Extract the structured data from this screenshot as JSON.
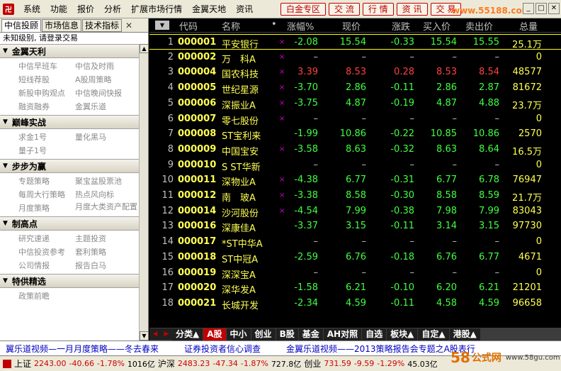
{
  "menu": [
    "系统",
    "功能",
    "报价",
    "分析",
    "扩展市场行情",
    "金翼天地",
    "资讯"
  ],
  "quick_buttons": [
    "白金专区",
    "交 流",
    "行 情",
    "资 讯",
    "交 易"
  ],
  "watermark_top": "www.55188.com",
  "window_controls": [
    "_",
    "□",
    "✕"
  ],
  "left_panel": {
    "tabs": [
      "中信投顾",
      "市场信息",
      "技术指标"
    ],
    "close": "✕",
    "login_msg": "未知级别, 请登录交易",
    "sections": [
      {
        "title": "金翼天利",
        "items": [
          "中信早班车",
          "中信及时雨",
          "短线荐股",
          "A股周策略",
          "新股申购观点",
          "中信晚间快报",
          "融资融券",
          "金翼乐道"
        ]
      },
      {
        "title": "巅峰实战",
        "items": [
          "求金1号",
          "量化黑马",
          "量子1号"
        ]
      },
      {
        "title": "步步为赢",
        "items": [
          "专题策略",
          "聚宝盆股票池",
          "每周大行策略",
          "热点风向标",
          "月度策略",
          "月度大类资产配置"
        ]
      },
      {
        "title": "制高点",
        "items": [
          "研究速递",
          "主题投资",
          "中信投资参考",
          "套利策略",
          "公司情报",
          "报告白马"
        ]
      },
      {
        "title": "特供精选",
        "items": [
          "政策前瞻"
        ]
      }
    ]
  },
  "table": {
    "headers": {
      "code": "代码",
      "name": "名称",
      "dot": "•",
      "pct": "涨幅%",
      "price": "现价",
      "chg": "涨跌",
      "buy": "买入价",
      "sell": "卖出价",
      "vol": "总量"
    },
    "rows": [
      {
        "idx": "1",
        "code": "000001",
        "name": "平安银行",
        "mark": "×",
        "pct": "-2.08",
        "price": "15.54",
        "chg": "-0.33",
        "buy": "15.54",
        "sell": "15.55",
        "vol": "25.1万",
        "dir": "down"
      },
      {
        "idx": "2",
        "code": "000002",
        "name": "万　科A",
        "mark": "×",
        "pct": "–",
        "price": "–",
        "chg": "–",
        "buy": "–",
        "sell": "–",
        "vol": "0",
        "dir": "flat"
      },
      {
        "idx": "3",
        "code": "000004",
        "name": "国农科技",
        "mark": "×",
        "pct": "3.39",
        "price": "8.53",
        "chg": "0.28",
        "buy": "8.53",
        "sell": "8.54",
        "vol": "48577",
        "dir": "up"
      },
      {
        "idx": "4",
        "code": "000005",
        "name": "世纪星源",
        "mark": "×",
        "pct": "-3.70",
        "price": "2.86",
        "chg": "-0.11",
        "buy": "2.86",
        "sell": "2.87",
        "vol": "81672",
        "dir": "down"
      },
      {
        "idx": "5",
        "code": "000006",
        "name": "深振业A",
        "mark": "×",
        "pct": "-3.75",
        "price": "4.87",
        "chg": "-0.19",
        "buy": "4.87",
        "sell": "4.88",
        "vol": "23.7万",
        "dir": "down"
      },
      {
        "idx": "6",
        "code": "000007",
        "name": "零七股份",
        "mark": "×",
        "pct": "–",
        "price": "–",
        "chg": "–",
        "buy": "–",
        "sell": "–",
        "vol": "0",
        "dir": "flat"
      },
      {
        "idx": "7",
        "code": "000008",
        "name": "ST宝利来",
        "mark": "",
        "pct": "-1.99",
        "price": "10.86",
        "chg": "-0.22",
        "buy": "10.85",
        "sell": "10.86",
        "vol": "2570",
        "dir": "down"
      },
      {
        "idx": "8",
        "code": "000009",
        "name": "中国宝安",
        "mark": "×",
        "pct": "-3.58",
        "price": "8.63",
        "chg": "-0.32",
        "buy": "8.63",
        "sell": "8.64",
        "vol": "16.5万",
        "dir": "down"
      },
      {
        "idx": "9",
        "code": "000010",
        "name": "S ST华新",
        "mark": "",
        "pct": "–",
        "price": "–",
        "chg": "–",
        "buy": "–",
        "sell": "–",
        "vol": "0",
        "dir": "flat"
      },
      {
        "idx": "10",
        "code": "000011",
        "name": "深物业A",
        "mark": "×",
        "pct": "-4.38",
        "price": "6.77",
        "chg": "-0.31",
        "buy": "6.77",
        "sell": "6.78",
        "vol": "76947",
        "dir": "down"
      },
      {
        "idx": "11",
        "code": "000012",
        "name": "南　玻A",
        "mark": "×",
        "pct": "-3.38",
        "price": "8.58",
        "chg": "-0.30",
        "buy": "8.58",
        "sell": "8.59",
        "vol": "21.7万",
        "dir": "down"
      },
      {
        "idx": "12",
        "code": "000014",
        "name": "沙河股份",
        "mark": "×",
        "pct": "-4.54",
        "price": "7.99",
        "chg": "-0.38",
        "buy": "7.98",
        "sell": "7.99",
        "vol": "83043",
        "dir": "down"
      },
      {
        "idx": "13",
        "code": "000016",
        "name": "深康佳A",
        "mark": "",
        "pct": "-3.37",
        "price": "3.15",
        "chg": "-0.11",
        "buy": "3.14",
        "sell": "3.15",
        "vol": "97730",
        "dir": "down"
      },
      {
        "idx": "14",
        "code": "000017",
        "name": "*ST中华A",
        "mark": "",
        "pct": "–",
        "price": "–",
        "chg": "–",
        "buy": "–",
        "sell": "–",
        "vol": "0",
        "dir": "flat"
      },
      {
        "idx": "15",
        "code": "000018",
        "name": "ST中冠A",
        "mark": "",
        "pct": "-2.59",
        "price": "6.76",
        "chg": "-0.18",
        "buy": "6.76",
        "sell": "6.77",
        "vol": "4671",
        "dir": "down"
      },
      {
        "idx": "16",
        "code": "000019",
        "name": "深深宝A",
        "mark": "",
        "pct": "–",
        "price": "–",
        "chg": "–",
        "buy": "–",
        "sell": "–",
        "vol": "0",
        "dir": "flat"
      },
      {
        "idx": "17",
        "code": "000020",
        "name": "深华发A",
        "mark": "",
        "pct": "-1.58",
        "price": "6.21",
        "chg": "-0.10",
        "buy": "6.20",
        "sell": "6.21",
        "vol": "21201",
        "dir": "down"
      },
      {
        "idx": "18",
        "code": "000021",
        "name": "长城开发",
        "mark": "",
        "pct": "-2.34",
        "price": "4.59",
        "chg": "-0.11",
        "buy": "4.58",
        "sell": "4.59",
        "vol": "96658",
        "dir": "down"
      }
    ]
  },
  "bottom_tabs": [
    "分类▲",
    "A股",
    "中小",
    "创业",
    "B股",
    "基金",
    "AH对照",
    "自选",
    "板块▲",
    "自定▲",
    "港股▲"
  ],
  "bottom_active": "A股",
  "ticker": [
    "翼乐道视频—一月月度策略——冬去春来",
    "证券投资者信心调查",
    "金翼乐道视频——2013策略报告会专题之A股表行"
  ],
  "status": {
    "sh_label": "上证",
    "sh_value": "2243.00",
    "sh_chg": "-40.66",
    "sh_pct": "-1.78%",
    "sh_amt": "1016亿",
    "sz_label": "沪深",
    "sz_value": "2483.23",
    "sz_chg": "-47.34",
    "sz_pct": "-1.87%",
    "sz_amt": "727.8亿",
    "cy_label": "创业",
    "cy_value": "731.59",
    "cy_chg": "-9.59",
    "cy_pct": "-1.29%",
    "cy_amt": "45.03亿"
  },
  "watermark_bottom": {
    "num": "58",
    "text": "公式网",
    "site": "www.58gu.com"
  }
}
